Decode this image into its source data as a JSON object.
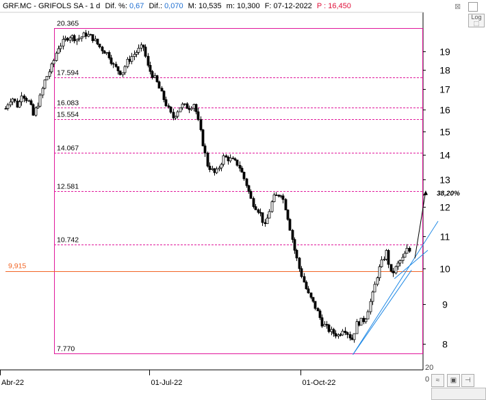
{
  "header": {
    "ticker": "GRF.MC - GRIFOLS SA - ",
    "interval": "1 d",
    "dif_pct_label": "Dif. %:",
    "dif_pct_value": "0,67",
    "dif_label": "Dif.:",
    "dif_value": "0,070",
    "max_label": "M:",
    "max_value": "10,535",
    "min_label": "m:",
    "min_value": "10,300",
    "date_label": "F:",
    "date_value": "07-12-2022",
    "price_label": "P :",
    "price_value": "16,450"
  },
  "controls": {
    "close_glyph": "⊠",
    "log_label": "Log",
    "scroll_top": "20",
    "scroll_bottom": "0"
  },
  "colors": {
    "fib": "#e0149a",
    "hline": "#f26322",
    "trend": "#1e88e5",
    "candle": "#000000",
    "axis": "#000000",
    "pct": "#000000"
  },
  "chart_data": {
    "type": "candlestick",
    "y_scale": "log",
    "ylim": [
      7.5,
      20.8
    ],
    "y_ticks": [
      8,
      9,
      10,
      11,
      12,
      13,
      14,
      15,
      16,
      17,
      18,
      19
    ],
    "x_labels": [
      "Abr-22",
      "01-Jul-22",
      "01-Oct-22"
    ],
    "fib_levels": [
      {
        "label": "20.365",
        "value": 20.365,
        "solid": true
      },
      {
        "label": "17.594",
        "value": 17.594,
        "solid": false
      },
      {
        "label": "16.083",
        "value": 16.083,
        "solid": false
      },
      {
        "label": "15.554",
        "value": 15.554,
        "solid": false
      },
      {
        "label": "14.067",
        "value": 14.067,
        "solid": false
      },
      {
        "label": "12.581",
        "value": 12.581,
        "solid": false
      },
      {
        "label": "10.742",
        "value": 10.742,
        "solid": false
      },
      {
        "label": "7.770",
        "value": 7.77,
        "solid": true
      }
    ],
    "horizontal_line": {
      "label": "9,915",
      "value": 9.915
    },
    "annotation": {
      "label": "38,20%",
      "target": 12.581
    },
    "price_path": [
      [
        "2022-04-01",
        15.3
      ],
      [
        "2022-04-05",
        16.2
      ],
      [
        "2022-04-08",
        16.6
      ],
      [
        "2022-04-12",
        16.1
      ],
      [
        "2022-04-14",
        16.8
      ],
      [
        "2022-04-19",
        16.3
      ],
      [
        "2022-04-21",
        15.7
      ],
      [
        "2022-04-25",
        16.5
      ],
      [
        "2022-04-28",
        17.4
      ],
      [
        "2022-05-03",
        18.3
      ],
      [
        "2022-05-06",
        19.2
      ],
      [
        "2022-05-10",
        19.6
      ],
      [
        "2022-05-13",
        19.9
      ],
      [
        "2022-05-18",
        19.7
      ],
      [
        "2022-05-23",
        20.0
      ],
      [
        "2022-05-27",
        19.8
      ],
      [
        "2022-06-01",
        19.2
      ],
      [
        "2022-06-06",
        18.8
      ],
      [
        "2022-06-09",
        18.2
      ],
      [
        "2022-06-14",
        17.8
      ],
      [
        "2022-06-17",
        18.4
      ],
      [
        "2022-06-22",
        18.9
      ],
      [
        "2022-06-27",
        19.3
      ],
      [
        "2022-06-30",
        18.1
      ],
      [
        "2022-07-05",
        17.4
      ],
      [
        "2022-07-08",
        16.8
      ],
      [
        "2022-07-13",
        15.9
      ],
      [
        "2022-07-15",
        15.6
      ],
      [
        "2022-07-20",
        16.2
      ],
      [
        "2022-07-25",
        16.1
      ],
      [
        "2022-07-28",
        16.3
      ],
      [
        "2022-08-02",
        14.6
      ],
      [
        "2022-08-05",
        13.6
      ],
      [
        "2022-08-10",
        13.2
      ],
      [
        "2022-08-15",
        13.9
      ],
      [
        "2022-08-19",
        13.8
      ],
      [
        "2022-08-24",
        13.6
      ],
      [
        "2022-08-29",
        12.8
      ],
      [
        "2022-09-01",
        12.2
      ],
      [
        "2022-09-06",
        11.8
      ],
      [
        "2022-09-09",
        11.3
      ],
      [
        "2022-09-14",
        12.3
      ],
      [
        "2022-09-19",
        12.5
      ],
      [
        "2022-09-22",
        11.9
      ],
      [
        "2022-09-27",
        10.6
      ],
      [
        "2022-09-30",
        10.0
      ],
      [
        "2022-10-05",
        9.3
      ],
      [
        "2022-10-10",
        8.9
      ],
      [
        "2022-10-14",
        8.5
      ],
      [
        "2022-10-19",
        8.3
      ],
      [
        "2022-10-24",
        8.2
      ],
      [
        "2022-10-27",
        8.4
      ],
      [
        "2022-11-01",
        8.1
      ],
      [
        "2022-11-04",
        8.5
      ],
      [
        "2022-11-09",
        8.6
      ],
      [
        "2022-11-14",
        9.3
      ],
      [
        "2022-11-17",
        9.9
      ],
      [
        "2022-11-22",
        10.5
      ],
      [
        "2022-11-25",
        9.8
      ],
      [
        "2022-11-30",
        10.2
      ],
      [
        "2022-12-02",
        10.3
      ],
      [
        "2022-12-05",
        10.6
      ],
      [
        "2022-12-07",
        10.45
      ]
    ]
  }
}
